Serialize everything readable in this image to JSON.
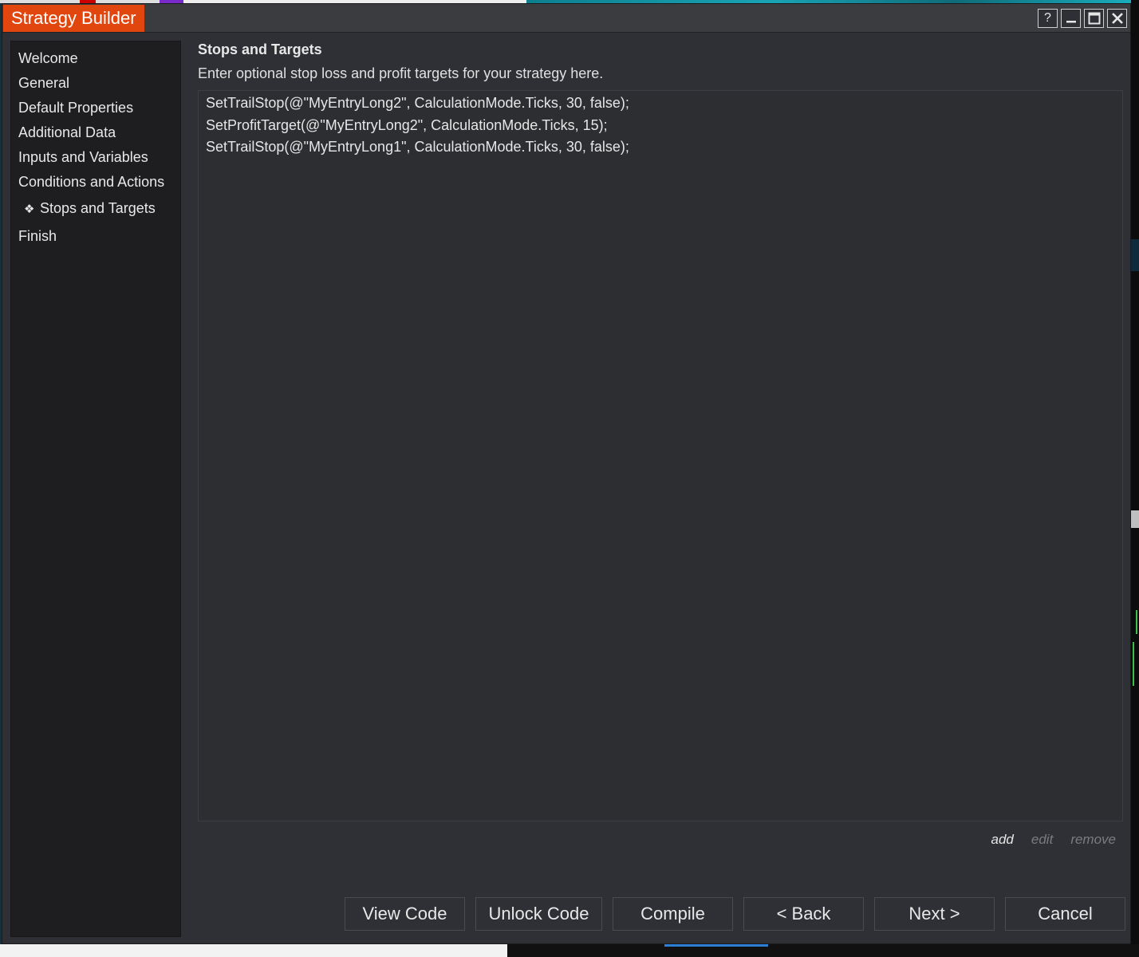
{
  "window": {
    "title": "Strategy Builder",
    "controls": {
      "help": "?",
      "minimize": "—",
      "maximize": "☐",
      "close": "✕"
    },
    "accent_color": "#e0460e"
  },
  "sidebar": {
    "items": [
      {
        "label": "Welcome",
        "active": false
      },
      {
        "label": "General",
        "active": false
      },
      {
        "label": "Default Properties",
        "active": false
      },
      {
        "label": "Additional Data",
        "active": false
      },
      {
        "label": "Inputs and Variables",
        "active": false
      },
      {
        "label": "Conditions and Actions",
        "active": false
      },
      {
        "label": "Stops and Targets",
        "active": true,
        "bullet": "❖"
      },
      {
        "label": "Finish",
        "active": false
      }
    ]
  },
  "content": {
    "heading": "Stops and Targets",
    "description": "Enter optional stop loss and profit targets for your strategy here.",
    "entries": [
      "SetTrailStop(@\"MyEntryLong2\", CalculationMode.Ticks, 30, false);",
      "SetProfitTarget(@\"MyEntryLong2\", CalculationMode.Ticks, 15);",
      "SetTrailStop(@\"MyEntryLong1\", CalculationMode.Ticks, 30, false);"
    ],
    "list_actions": {
      "add": "add",
      "edit": "edit",
      "remove": "remove"
    }
  },
  "footer": {
    "view_code": "View Code",
    "unlock_code": "Unlock Code",
    "compile": "Compile",
    "back": "< Back",
    "next": "Next >",
    "cancel": "Cancel"
  }
}
